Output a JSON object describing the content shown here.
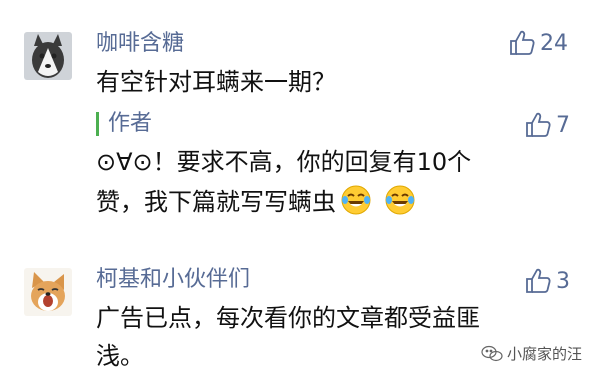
{
  "comments": [
    {
      "nickname": "咖啡含糖",
      "text": "有空针对耳螨来一期？",
      "likes": "24"
    },
    {
      "nickname": "柯基和小伙伴们",
      "text_line1": "广告已点，每次看你的文章都受益匪",
      "text_line2": "浅。",
      "likes": "3"
    }
  ],
  "reply": {
    "author_label": "作者",
    "text_line1": "⊙∀⊙！要求不高，你的回复有10个",
    "text_line2": "赞，我下篇就写写螨虫",
    "likes": "7"
  },
  "watermark": "小腐家的汪",
  "colors": {
    "nickname": "#576b95",
    "reply_bar": "#4caf50"
  },
  "icons": {
    "like": "thumbs-up-icon",
    "emoji": "tears-of-joy-emoji",
    "watermark": "wechat-icon"
  }
}
